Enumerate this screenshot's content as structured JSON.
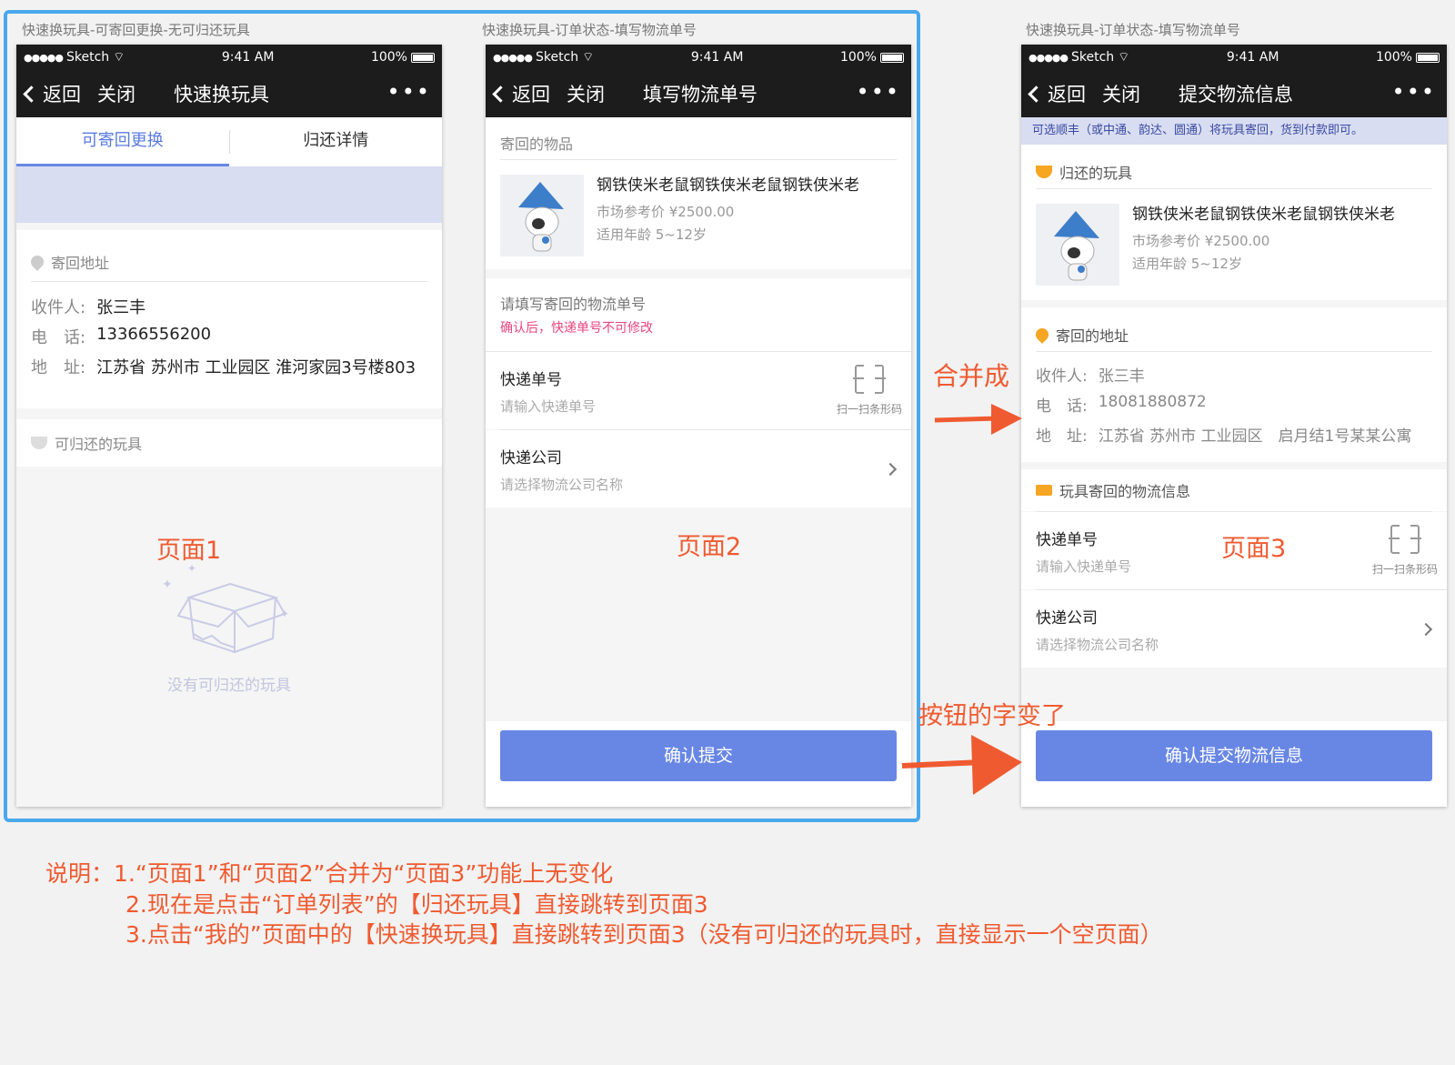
{
  "screens": [
    {
      "caption": "快速换玩具-可寄回更换-无可归还玩具",
      "status": {
        "carrier": "Sketch",
        "time": "9:41 AM",
        "battery": "100%"
      },
      "nav": {
        "back": "返回",
        "close": "关闭",
        "title": "快速换玩具",
        "more": "•••"
      },
      "tabs": [
        "可寄回更换",
        "归还详情"
      ],
      "address_header": "寄回地址",
      "recipient": {
        "label": "收件人:",
        "value": "张三丰"
      },
      "phone": {
        "label": "电　话:",
        "value": "13366556200"
      },
      "address": {
        "label": "地　址:",
        "value": "江苏省 苏州市 工业园区 淮河家园3号楼803"
      },
      "toys_header": "可归还的玩具",
      "empty_text": "没有可归还的玩具",
      "page_label": "页面1"
    },
    {
      "caption": "快速换玩具-订单状态-填写物流单号",
      "status": {
        "carrier": "Sketch",
        "time": "9:41 AM",
        "battery": "100%"
      },
      "nav": {
        "back": "返回",
        "close": "关闭",
        "title": "填写物流单号",
        "more": "•••"
      },
      "items_header": "寄回的物品",
      "toy": {
        "name": "钢铁侠米老鼠钢铁侠米老鼠钢铁侠米老",
        "price": "市场参考价 ¥2500.00",
        "age": "适用年龄 5~12岁"
      },
      "fill_header": "请填写寄回的物流单号",
      "warning": "确认后，快递单号不可修改",
      "tracking": {
        "label": "快递单号",
        "placeholder": "请输入快递单号",
        "scan": "扫一扫条形码"
      },
      "company": {
        "label": "快递公司",
        "placeholder": "请选择物流公司名称"
      },
      "submit": "确认提交",
      "page_label": "页面2"
    },
    {
      "caption": "快速换玩具-订单状态-填写物流单号",
      "status": {
        "carrier": "Sketch",
        "time": "9:41 AM",
        "battery": "100%"
      },
      "nav": {
        "back": "返回",
        "close": "关闭",
        "title": "提交物流信息",
        "more": "•••"
      },
      "banner": "可选顺丰（或中通、韵达、圆通）将玩具寄回，货到付款即可。",
      "toys_header": "归还的玩具",
      "toy": {
        "name": "钢铁侠米老鼠钢铁侠米老鼠钢铁侠米老",
        "price": "市场参考价 ¥2500.00",
        "age": "适用年龄 5~12岁"
      },
      "address_header": "寄回的地址",
      "recipient": {
        "label": "收件人:",
        "value": "张三丰"
      },
      "phone": {
        "label": "电　话:",
        "value": "18081880872"
      },
      "address": {
        "label": "地　址:",
        "value": "江苏省 苏州市 工业园区　启月结1号某某公寓"
      },
      "logistics_header": "玩具寄回的物流信息",
      "tracking": {
        "label": "快递单号",
        "placeholder": "请输入快递单号",
        "scan": "扫一扫条形码"
      },
      "company": {
        "label": "快递公司",
        "placeholder": "请选择物流公司名称"
      },
      "submit": "确认提交物流信息",
      "page_label": "页面3"
    }
  ],
  "annotations": {
    "merge": "合并成",
    "button_changed": "按钮的字变了",
    "note_line1": "说明：1.“页面1”和“页面2”合并为“页面3”功能上无变化",
    "note_line2": "2.现在是点击“订单列表”的【归还玩具】直接跳转到页面3",
    "note_line3": "3.点击“我的”页面中的【快速换玩具】直接跳转到页面3（没有可归还的玩具时，直接显示一个空页面）"
  },
  "colors": {
    "accent": "#6887e5",
    "annotation": "#f05a30",
    "frame": "#4aa8ec",
    "warning": "#e8457d",
    "icon_orange": "#f6a623"
  }
}
